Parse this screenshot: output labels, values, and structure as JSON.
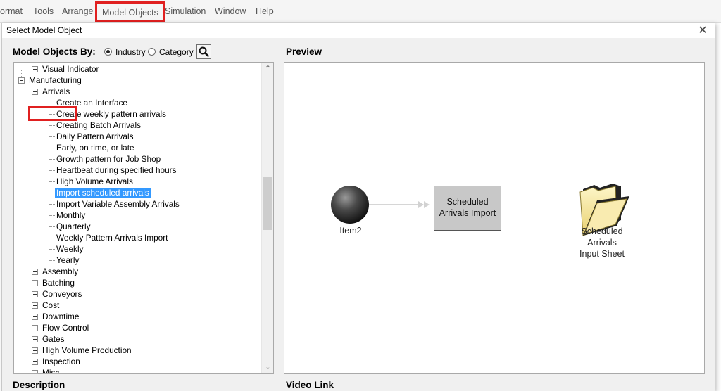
{
  "menu": {
    "items": [
      "ormat",
      "Tools",
      "Arrange",
      "Model Objects",
      "Simulation",
      "Window",
      "Help"
    ]
  },
  "dialog": {
    "title": "Select Model Object",
    "close_glyph": "✕",
    "objects_by_label": "Model Objects By:",
    "radio_industry": "Industry",
    "radio_category": "Category",
    "preview_label": "Preview",
    "description_label": "Description",
    "video_link_label": "Video Link"
  },
  "tree": {
    "visual_indicator": "Visual Indicator",
    "manufacturing": "Manufacturing",
    "arrivals": "Arrivals",
    "arrivals_children": [
      "Create an Interface",
      "Create weekly pattern arrivals",
      "Creating Batch Arrivals",
      "Daily Pattern Arrivals",
      "Early, on time, or late",
      "Growth pattern for Job Shop",
      "Heartbeat during specified hours",
      "High Volume Arrivals",
      "Import scheduled arrivals",
      "Import Variable Assembly Arrivals",
      "Monthly",
      "Quarterly",
      "Weekly Pattern Arrivals Import",
      "Weekly",
      "Yearly"
    ],
    "selected_index": 8,
    "categories": [
      "Assembly",
      "Batching",
      "Conveyors",
      "Cost",
      "Downtime",
      "Flow Control",
      "Gates",
      "High Volume Production",
      "Inspection",
      "Misc"
    ]
  },
  "preview": {
    "item_label": "Item2",
    "block_label_line1": "Scheduled",
    "block_label_line2": "Arrivals Import",
    "folder_label_line1": "Scheduled",
    "folder_label_line2": "Arrivals",
    "folder_label_line3": "Input Sheet"
  },
  "colors": {
    "highlight_red": "#e02020",
    "selection_blue": "#3399ff",
    "block_gray": "#c8c8c8",
    "folder_yellow": "#f7e89a"
  }
}
